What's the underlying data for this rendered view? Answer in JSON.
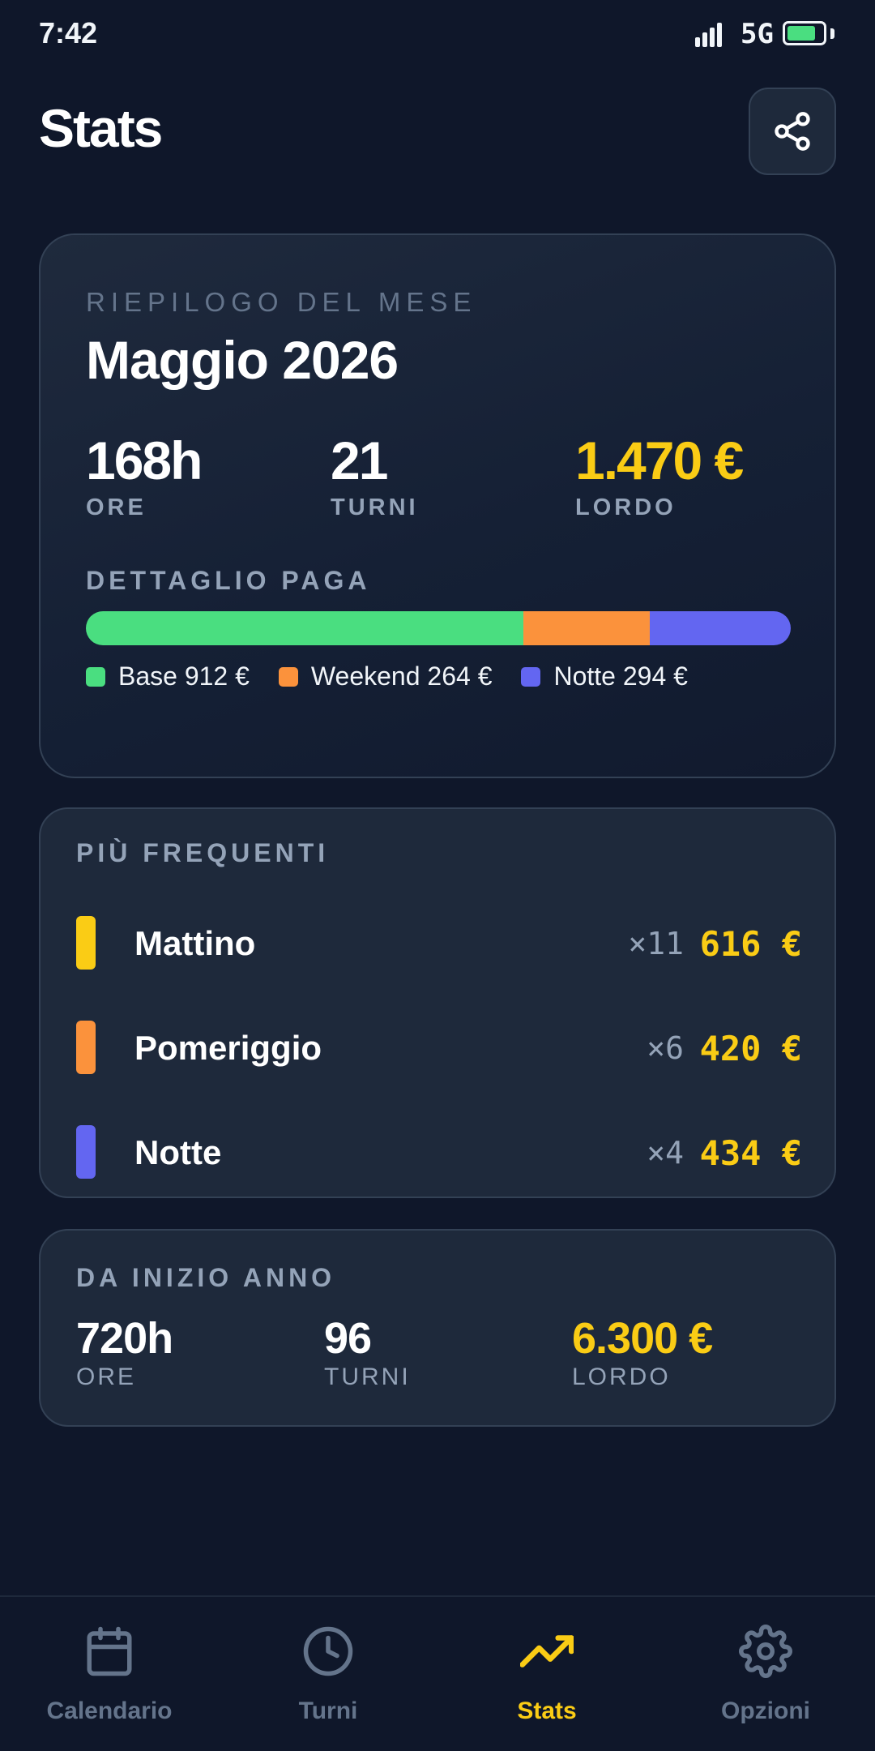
{
  "status_bar": {
    "time": "7:42",
    "network": "5G",
    "battery_level": 0.8,
    "signal_bars": 4
  },
  "header": {
    "title": "Stats",
    "share_icon": "share-icon"
  },
  "month_summary": {
    "overline": "RIEPILOGO DEL MESE",
    "title": "Maggio 2026",
    "stats": [
      {
        "value": "168h",
        "label": "ORE"
      },
      {
        "value": "21",
        "label": "TURNI"
      },
      {
        "value": "1.470 €",
        "label": "LORDO"
      }
    ],
    "pay_detail": {
      "label": "DETTAGLIO PAGA",
      "segments": [
        {
          "name": "Base",
          "amount": 912,
          "legend": "Base 912 €",
          "color": "#4ade80"
        },
        {
          "name": "Weekend",
          "amount": 264,
          "legend": "Weekend 264 €",
          "color": "#fb923c"
        },
        {
          "name": "Notte",
          "amount": 294,
          "legend": "Notte 294 €",
          "color": "#6366f1"
        }
      ]
    }
  },
  "frequent": {
    "label": "PIÙ FREQUENTI",
    "rows": [
      {
        "name": "Mattino",
        "count": "×11",
        "amount": "616 €",
        "color": "#facc15"
      },
      {
        "name": "Pomeriggio",
        "count": "×6",
        "amount": "420 €",
        "color": "#fb923c"
      },
      {
        "name": "Notte",
        "count": "×4",
        "amount": "434 €",
        "color": "#6366f1"
      }
    ]
  },
  "year_to_date": {
    "label": "DA INIZIO ANNO",
    "stats": [
      {
        "value": "720h",
        "label": "ORE"
      },
      {
        "value": "96",
        "label": "TURNI"
      },
      {
        "value": "6.300 €",
        "label": "LORDO"
      }
    ]
  },
  "tabbar": {
    "tabs": [
      {
        "label": "Calendario",
        "icon": "calendar-icon",
        "active": false
      },
      {
        "label": "Turni",
        "icon": "clock-icon",
        "active": false
      },
      {
        "label": "Stats",
        "icon": "trending-up-icon",
        "active": true
      },
      {
        "label": "Opzioni",
        "icon": "gear-icon",
        "active": false
      }
    ]
  },
  "colors": {
    "accent": "#facc15",
    "background": "#0f172a",
    "card": "#1e293b",
    "muted": "#94a3b8"
  }
}
